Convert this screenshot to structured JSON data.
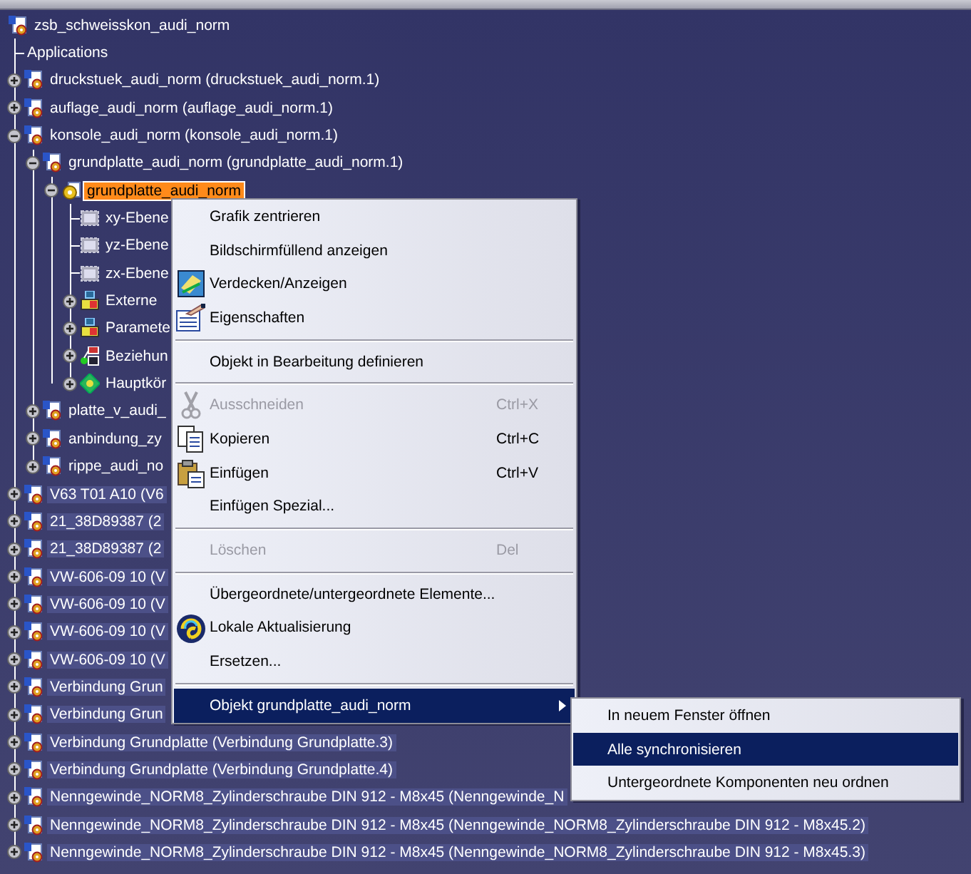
{
  "tree": {
    "label": "zsb_schweisskon_audi_norm",
    "kind": "product",
    "selected": false,
    "highlighted": false,
    "children": [
      {
        "label": "Applications",
        "kind": "text",
        "selected": false,
        "highlighted": false
      },
      {
        "label": "druckstuek_audi_norm (druckstuek_audi_norm.1)",
        "kind": "product",
        "expanded": false,
        "selected": false,
        "highlighted": false
      },
      {
        "label": "auflage_audi_norm (auflage_audi_norm.1)",
        "kind": "product",
        "expanded": false,
        "selected": false,
        "highlighted": false
      },
      {
        "label": "konsole_audi_norm (konsole_audi_norm.1)",
        "kind": "product",
        "expanded": true,
        "selected": false,
        "highlighted": false,
        "children": [
          {
            "label": "grundplatte_audi_norm (grundplatte_audi_norm.1)",
            "kind": "product",
            "expanded": true,
            "selected": false,
            "highlighted": false,
            "children": [
              {
                "label": "grundplatte_audi_norm",
                "kind": "part",
                "expanded": true,
                "selected": true,
                "children": [
                  {
                    "label": "xy-Ebene",
                    "kind": "plane",
                    "selected": false,
                    "highlighted": false
                  },
                  {
                    "label": "yz-Ebene",
                    "kind": "plane",
                    "selected": false,
                    "highlighted": false
                  },
                  {
                    "label": "zx-Ebene",
                    "kind": "plane",
                    "selected": false,
                    "highlighted": false
                  },
                  {
                    "label": "Externe",
                    "kind": "parameters",
                    "expanded": false,
                    "selected": false,
                    "highlighted": false
                  },
                  {
                    "label": "Paramete",
                    "kind": "parameters",
                    "expanded": false,
                    "selected": false,
                    "highlighted": false
                  },
                  {
                    "label": "Beziehun",
                    "kind": "relations",
                    "expanded": false,
                    "selected": false,
                    "highlighted": false
                  },
                  {
                    "label": "Hauptkör",
                    "kind": "body",
                    "expanded": false,
                    "selected": false,
                    "highlighted": false
                  }
                ]
              }
            ]
          },
          {
            "label": "platte_v_audi_",
            "kind": "product",
            "expanded": false,
            "selected": false,
            "highlighted": false
          },
          {
            "label": "anbindung_zy",
            "kind": "product",
            "expanded": false,
            "selected": false,
            "highlighted": false
          },
          {
            "label": "rippe_audi_no",
            "kind": "product",
            "expanded": false,
            "selected": false,
            "highlighted": false
          }
        ]
      },
      {
        "label": "V63 T01 A10 (V6",
        "kind": "product",
        "expanded": false,
        "selected": false,
        "highlighted": true
      },
      {
        "label": "21_38D89387 (2",
        "kind": "product",
        "expanded": false,
        "selected": false,
        "highlighted": true
      },
      {
        "label": "21_38D89387 (2",
        "kind": "product",
        "expanded": false,
        "selected": false,
        "highlighted": true
      },
      {
        "label": "VW-606-09 10 (V",
        "kind": "product",
        "expanded": false,
        "selected": false,
        "highlighted": true
      },
      {
        "label": "VW-606-09 10 (V",
        "kind": "product",
        "expanded": false,
        "selected": false,
        "highlighted": true
      },
      {
        "label": "VW-606-09 10 (V",
        "kind": "product",
        "expanded": false,
        "selected": false,
        "highlighted": true
      },
      {
        "label": "VW-606-09 10 (V",
        "kind": "product",
        "expanded": false,
        "selected": false,
        "highlighted": true
      },
      {
        "label": "Verbindung Grun",
        "kind": "product",
        "expanded": false,
        "selected": false,
        "highlighted": true
      },
      {
        "label": "Verbindung Grun",
        "kind": "product",
        "expanded": false,
        "selected": false,
        "highlighted": true
      },
      {
        "label": "Verbindung Grundplatte (Verbindung Grundplatte.3)",
        "kind": "product",
        "expanded": false,
        "selected": false,
        "highlighted": true
      },
      {
        "label": "Verbindung Grundplatte (Verbindung Grundplatte.4)",
        "kind": "product",
        "expanded": false,
        "selected": false,
        "highlighted": true
      },
      {
        "label": "Nenngewinde_NORM8_Zylinderschraube DIN 912 - M8x45 (Nenngewinde_N",
        "kind": "product",
        "expanded": false,
        "selected": false,
        "highlighted": true
      },
      {
        "label": "Nenngewinde_NORM8_Zylinderschraube DIN 912 - M8x45 (Nenngewinde_NORM8_Zylinderschraube DIN 912 - M8x45.2)",
        "kind": "product",
        "expanded": false,
        "selected": false,
        "highlighted": true
      },
      {
        "label": "Nenngewinde_NORM8_Zylinderschraube DIN 912 - M8x45 (Nenngewinde_NORM8_Zylinderschraube DIN 912 - M8x45.3)",
        "kind": "product",
        "expanded": false,
        "selected": false,
        "highlighted": true
      }
    ]
  },
  "context_menu": {
    "items": [
      {
        "kind": "item",
        "label": "Grafik zentrieren",
        "disabled": false,
        "selected": false
      },
      {
        "kind": "item",
        "label": "Bildschirmfüllend anzeigen",
        "disabled": false,
        "selected": false
      },
      {
        "kind": "item",
        "label": "Verdecken/Anzeigen",
        "disabled": false,
        "selected": false
      },
      {
        "kind": "item",
        "label": "Eigenschaften",
        "disabled": false,
        "selected": false
      },
      {
        "kind": "separator"
      },
      {
        "kind": "item",
        "label": "Objekt in Bearbeitung definieren",
        "disabled": false,
        "selected": false
      },
      {
        "kind": "separator"
      },
      {
        "kind": "item",
        "label": "Ausschneiden",
        "shortcut": "Ctrl+X",
        "disabled": true,
        "selected": false
      },
      {
        "kind": "item",
        "label": "Kopieren",
        "shortcut": "Ctrl+C",
        "disabled": false,
        "selected": false
      },
      {
        "kind": "item",
        "label": "Einfügen",
        "shortcut": "Ctrl+V",
        "disabled": false,
        "selected": false
      },
      {
        "kind": "item",
        "label": "Einfügen Spezial...",
        "disabled": false,
        "selected": false
      },
      {
        "kind": "separator"
      },
      {
        "kind": "item",
        "label": "Löschen",
        "shortcut": "Del",
        "disabled": true,
        "selected": false
      },
      {
        "kind": "separator"
      },
      {
        "kind": "item",
        "label": "Übergeordnete/untergeordnete Elemente...",
        "disabled": false,
        "selected": false
      },
      {
        "kind": "item",
        "label": "Lokale Aktualisierung",
        "disabled": false,
        "selected": false
      },
      {
        "kind": "item",
        "label": "Ersetzen...",
        "disabled": false,
        "selected": false
      },
      {
        "kind": "separator"
      },
      {
        "kind": "submenu",
        "label": "Objekt grundplatte_audi_norm",
        "disabled": false,
        "selected": true
      }
    ]
  },
  "submenu": {
    "items": [
      {
        "label": "In neuem Fenster öffnen",
        "selected": false
      },
      {
        "label": "Alle synchronisieren",
        "selected": true
      },
      {
        "label": "Untergeordnete Komponenten neu ordnen",
        "selected": false
      }
    ]
  }
}
